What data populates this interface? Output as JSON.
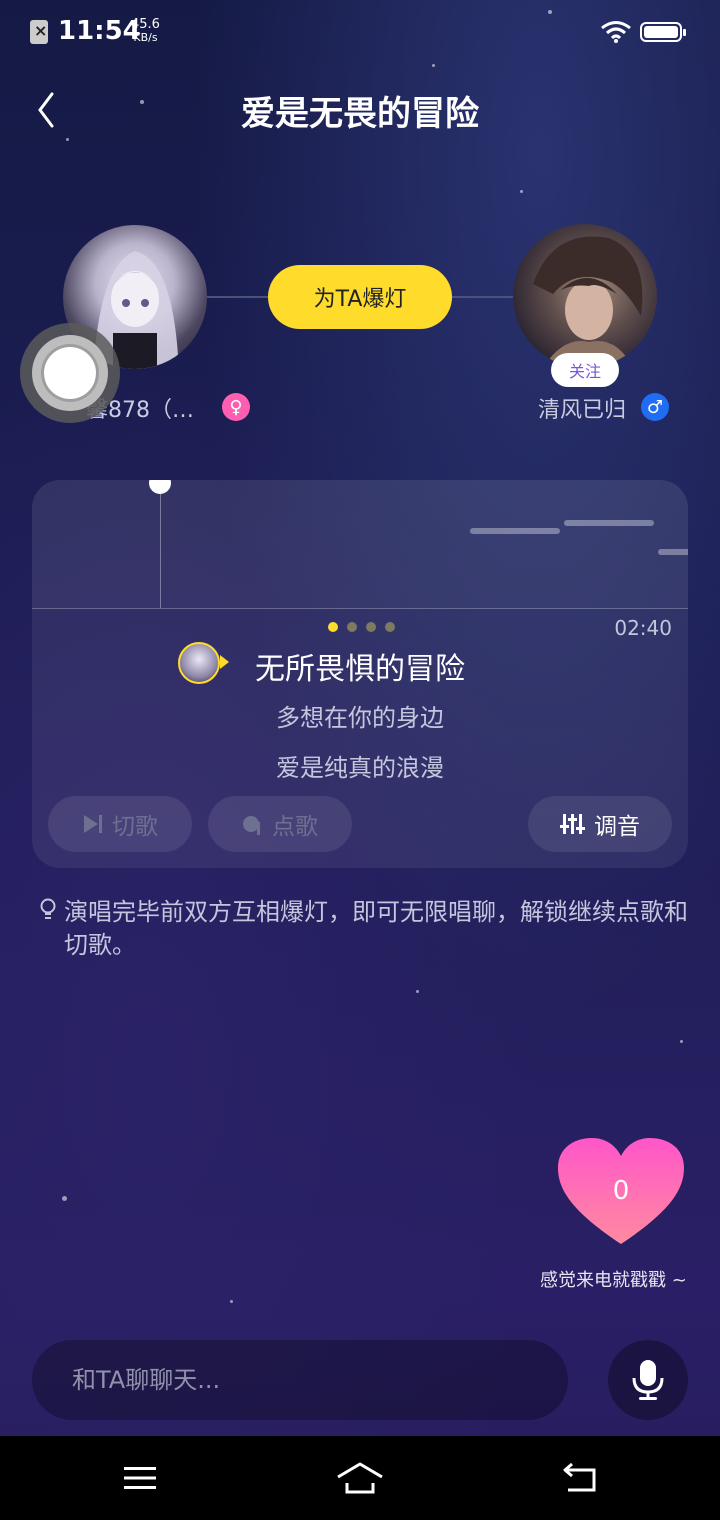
{
  "status_bar": {
    "time": "11:54",
    "net_speed_value": "45.6",
    "net_speed_unit": "KB/s",
    "icons": [
      "sim-icon",
      "wifi-icon",
      "battery-icon"
    ]
  },
  "header": {
    "title": "爱是无畏的冒险",
    "back_icon": "chevron-left-icon"
  },
  "duet": {
    "boost_label": "为TA爆灯",
    "left_user": {
      "name": "馨878（…",
      "gender_symbol": "♀",
      "gender_color": "#ff5fb0"
    },
    "right_user": {
      "name": "清风已归",
      "gender_symbol": "♂",
      "gender_color": "#1f6df2",
      "follow_label": "关注"
    }
  },
  "song_card": {
    "duration": "02:40",
    "lyrics": [
      "无所畏惧的冒险",
      "多想在你的身边",
      "爱是纯真的浪漫"
    ],
    "page_count": 4,
    "active_page": 1,
    "buttons": {
      "skip_label": "切歌",
      "request_label": "点歌",
      "tune_label": "调音"
    }
  },
  "tip": {
    "text": "演唱完毕前双方互相爆灯，即可无限唱聊，解锁继续点歌和切歌。"
  },
  "heart": {
    "count": "0",
    "hint": "感觉来电就戳戳 ~",
    "color_top": "#ff56c8",
    "color_bottom": "#ff8aa0"
  },
  "chat": {
    "placeholder": "和TA聊聊天..."
  },
  "colors": {
    "accent_yellow": "#ffdc2b",
    "follow_purple": "#7a55e0"
  }
}
